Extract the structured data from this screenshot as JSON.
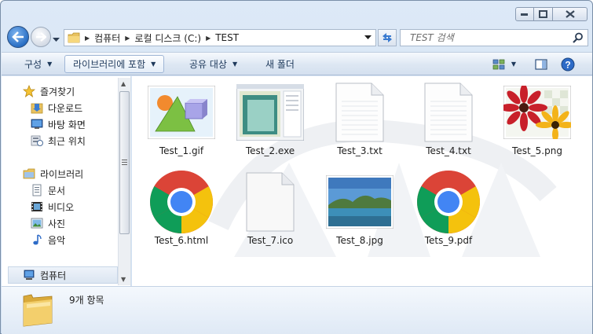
{
  "window": {
    "caption_buttons": [
      "minimize",
      "maximize",
      "close"
    ]
  },
  "address_bar": {
    "crumbs": [
      "컴퓨터",
      "로컬 디스크 (C:)",
      "TEST"
    ]
  },
  "search": {
    "placeholder": "TEST 검색"
  },
  "toolbar": {
    "organize": "구성",
    "include_library": "라이브러리에 포함",
    "share": "공유 대상",
    "new_folder": "새 폴더"
  },
  "navpane": {
    "favorites": {
      "label": "즐겨찾기",
      "items": [
        "다운로드",
        "바탕 화면",
        "최근 위치"
      ]
    },
    "libraries": {
      "label": "라이브러리",
      "items": [
        "문서",
        "비디오",
        "사진",
        "음악"
      ]
    },
    "computer": "컴퓨터"
  },
  "files": [
    {
      "name": "Test_1.gif",
      "icon": "gif-image-icon"
    },
    {
      "name": "Test_2.exe",
      "icon": "exe-window-icon"
    },
    {
      "name": "Test_3.txt",
      "icon": "text-file-icon"
    },
    {
      "name": "Test_4.txt",
      "icon": "text-file-icon"
    },
    {
      "name": "Test_5.png",
      "icon": "flower-image-icon"
    },
    {
      "name": "Test_6.html",
      "icon": "chrome-icon"
    },
    {
      "name": "Test_7.ico",
      "icon": "blank-file-icon"
    },
    {
      "name": "Test_8.jpg",
      "icon": "landscape-image-icon"
    },
    {
      "name": "Tets_9.pdf",
      "icon": "chrome-icon"
    }
  ],
  "status": {
    "item_count": "9개 항목"
  },
  "colors": {
    "frame": "#cfdff2",
    "toolbar_text": "#1e395b",
    "chrome_red": "#db4437",
    "chrome_yellow": "#f4c20d",
    "chrome_green": "#0f9d58",
    "chrome_blue": "#4285f4"
  }
}
